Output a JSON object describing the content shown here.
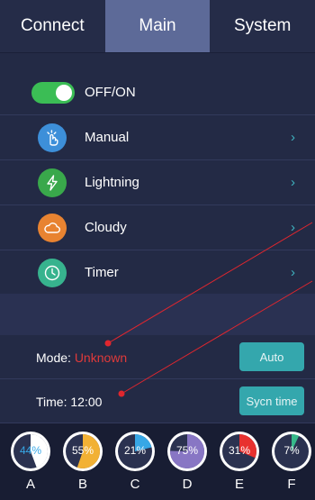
{
  "tabs": [
    {
      "label": "Connect"
    },
    {
      "label": "Main"
    },
    {
      "label": "System"
    }
  ],
  "power": {
    "label": "OFF/ON",
    "on": true
  },
  "modes": [
    {
      "label": "Manual",
      "icon": "hand-tap-icon",
      "color": "#3d8fd9"
    },
    {
      "label": "Lightning",
      "icon": "lightning-icon",
      "color": "#39a84b"
    },
    {
      "label": "Cloudy",
      "icon": "cloud-icon",
      "color": "#e88331"
    },
    {
      "label": "Timer",
      "icon": "clock-icon",
      "color": "#37b38e"
    }
  ],
  "chevron": "›",
  "mode": {
    "label": "Mode:",
    "value": "Unknown",
    "value_color": "#e03a3a",
    "button": "Auto"
  },
  "time": {
    "label": "Time:",
    "value": "12:00",
    "button": "Sycn time"
  },
  "channels": [
    {
      "name": "A",
      "percent": 44,
      "label": "44%",
      "color": "#ffffff"
    },
    {
      "name": "B",
      "percent": 55,
      "label": "55%",
      "color": "#f2b134"
    },
    {
      "name": "C",
      "percent": 21,
      "label": "21%",
      "color": "#37a7e6"
    },
    {
      "name": "D",
      "percent": 75,
      "label": "75%",
      "color": "#8876c4"
    },
    {
      "name": "E",
      "percent": 31,
      "label": "31%",
      "color": "#e8312f"
    },
    {
      "name": "F",
      "percent": 7,
      "label": "7%",
      "color": "#36b98a"
    }
  ],
  "colors": {
    "accent": "#34a7ad",
    "background": "#232a45",
    "active_tab": "#5d6a98"
  }
}
